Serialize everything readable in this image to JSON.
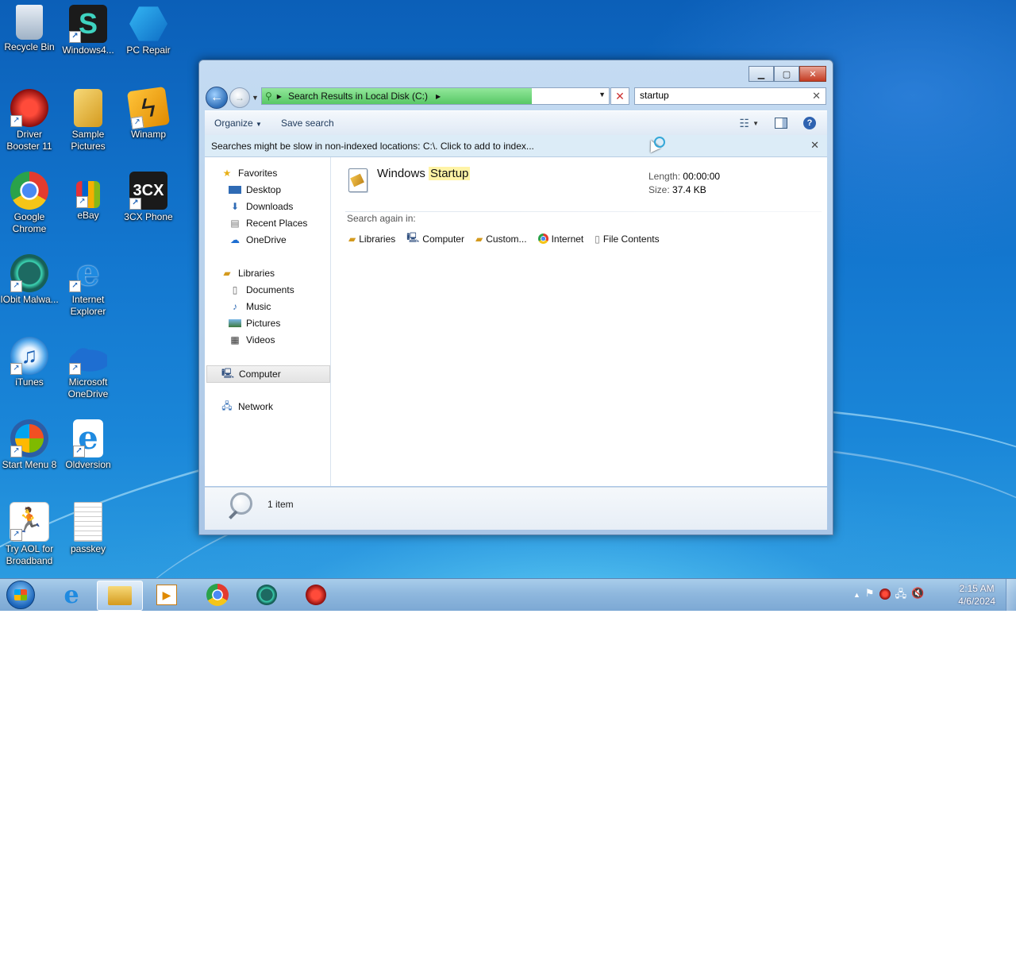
{
  "desktop_icons": [
    {
      "label": "Recycle Bin",
      "icon": "recycle-bin-icon"
    },
    {
      "label": "Windows4...",
      "icon": "windows4-icon"
    },
    {
      "label": "PC Repair",
      "icon": "pc-repair-icon"
    },
    {
      "label": "Driver Booster 11",
      "icon": "driver-booster-icon"
    },
    {
      "label": "Sample Pictures",
      "icon": "sample-pictures-icon"
    },
    {
      "label": "Winamp",
      "icon": "winamp-icon"
    },
    {
      "label": "Google Chrome",
      "icon": "chrome-icon"
    },
    {
      "label": "eBay",
      "icon": "ebay-icon"
    },
    {
      "label": "3CX Phone",
      "icon": "3cx-phone-icon"
    },
    {
      "label": "IObit Malwa...",
      "icon": "iobit-malware-icon"
    },
    {
      "label": "Internet Explorer",
      "icon": "internet-explorer-icon"
    },
    {
      "label": "iTunes",
      "icon": "itunes-icon"
    },
    {
      "label": "Microsoft OneDrive",
      "icon": "onedrive-icon"
    },
    {
      "label": "Start Menu 8",
      "icon": "start-menu-8-icon"
    },
    {
      "label": "Oldversion",
      "icon": "oldversion-icon"
    },
    {
      "label": "Try AOL for Broadband",
      "icon": "aol-icon"
    },
    {
      "label": "passkey",
      "icon": "text-file-icon"
    }
  ],
  "window": {
    "address": {
      "crumb": "Search Results in Local Disk (C:)"
    },
    "search": {
      "value": "startup"
    },
    "toolbar": {
      "organize": "Organize",
      "save_search": "Save search"
    },
    "infobar": "Searches might be slow in non-indexed locations: C:\\. Click to add to index...",
    "nav": {
      "favorites": "Favorites",
      "desktop": "Desktop",
      "downloads": "Downloads",
      "recent": "Recent Places",
      "onedrive": "OneDrive",
      "libraries": "Libraries",
      "documents": "Documents",
      "music": "Music",
      "pictures": "Pictures",
      "videos": "Videos",
      "computer": "Computer",
      "network": "Network"
    },
    "result": {
      "name_prefix": "Windows ",
      "name_highlight": "Startup",
      "length_label": "Length:",
      "length_value": "00:00:00",
      "size_label": "Size:",
      "size_value": "37.4 KB"
    },
    "search_again": {
      "label": "Search again in:",
      "libraries": "Libraries",
      "computer": "Computer",
      "custom": "Custom...",
      "internet": "Internet",
      "file_contents": "File Contents"
    },
    "status": {
      "count": "1 item"
    }
  },
  "taskbar": {
    "time": "2:15 AM",
    "date": "4/6/2024"
  },
  "colors": {
    "highlight": "#fff3a6",
    "progress": "#58c866",
    "close": "#c43b22"
  }
}
